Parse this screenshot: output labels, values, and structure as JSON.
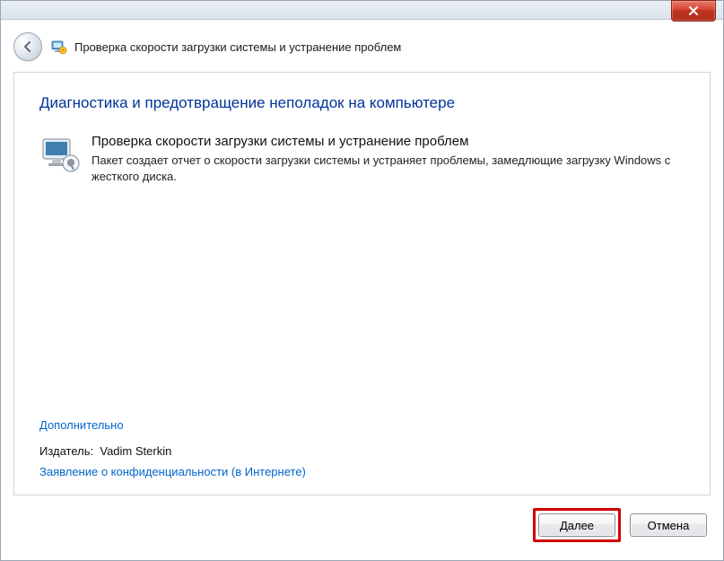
{
  "titlebar": {
    "close_aria": "Close"
  },
  "header": {
    "title": "Проверка скорости загрузки системы и устранение проблем"
  },
  "panel": {
    "heading": "Диагностика и предотвращение неполадок на компьютере",
    "tool_title": "Проверка скорости загрузки системы и устранение проблем",
    "tool_desc": "Пакет создает отчет о скорости загрузки системы и устраняет проблемы, замедлющие загрузку Windows с жесткого диска.",
    "advanced_link": "Дополнительно",
    "publisher_label": "Издатель:",
    "publisher_value": "Vadim Sterkin",
    "privacy_link": "Заявление о конфиденциальности (в Интернете)"
  },
  "buttons": {
    "next": "Далее",
    "cancel": "Отмена"
  }
}
